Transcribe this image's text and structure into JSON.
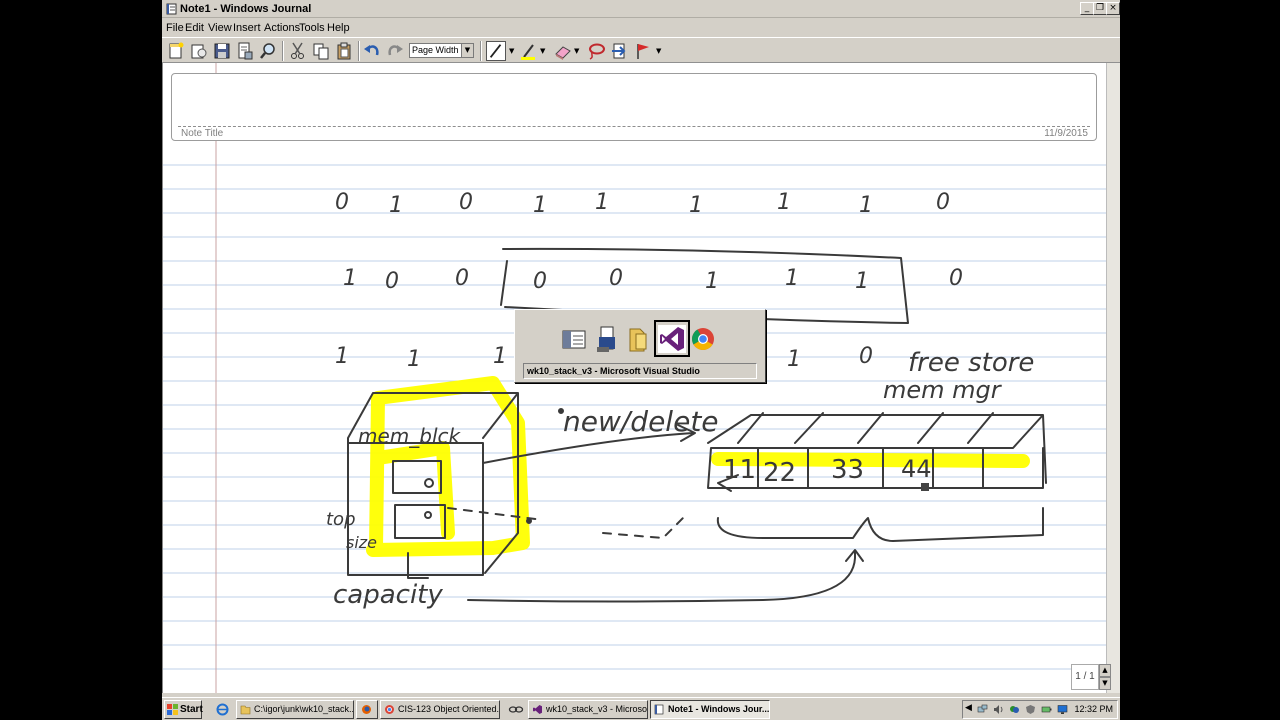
{
  "window": {
    "title": "Note1 - Windows Journal",
    "controls": {
      "minimize": "_",
      "restore": "❐",
      "close": "×"
    }
  },
  "menu": {
    "items": [
      "File",
      "Edit",
      "View",
      "Insert",
      "Actions",
      "Tools",
      "Help"
    ]
  },
  "toolbar": {
    "icons": [
      "new-note-icon",
      "open-icon",
      "save-icon",
      "print-icon",
      "find-icon",
      "cut-icon",
      "copy-icon",
      "paste-icon",
      "undo-icon",
      "redo-icon",
      "pen-icon",
      "highlighter-icon",
      "eraser-icon",
      "lasso-icon",
      "insert-space-icon",
      "flag-icon"
    ],
    "zoom_value": "Page Width"
  },
  "note": {
    "title_label": "Note Title",
    "date": "11/9/2015",
    "page_count": "1 / 1"
  },
  "ink": {
    "row1": [
      "0",
      "1",
      "0",
      "1",
      "1",
      "1",
      "1",
      "1",
      "0"
    ],
    "row2": [
      "1",
      "0",
      "0",
      "0",
      "0",
      "1",
      "1",
      "1",
      "0"
    ],
    "row3": [
      "1",
      "1",
      "1",
      "1",
      "0"
    ],
    "labels": {
      "free_store": "free store",
      "mem_mgr": "mem mgr",
      "new_delete": "new/delete",
      "mem_blck": "mem_blck",
      "top": "top",
      "size": "size",
      "capacity": "capacity"
    },
    "cells": [
      "11",
      "22",
      "33",
      "44"
    ],
    "colors": {
      "ink": "#3a3a3a",
      "highlight": "#ffff00"
    }
  },
  "switcher": {
    "icons": [
      "journal-app-icon",
      "journal-viewer-icon",
      "folder-icon",
      "visual-studio-icon",
      "chrome-icon"
    ],
    "selected_index": 3,
    "caption": "wk10_stack_v3 - Microsoft Visual Studio"
  },
  "taskbar": {
    "start_label": "Start",
    "quick_launch": [
      "ie-icon"
    ],
    "buttons": [
      {
        "label": "C:\\igor\\junk\\wk10_stack...",
        "icon": "folder-icon",
        "active": false
      },
      {
        "label": "",
        "icon": "firefox-icon",
        "active": false
      },
      {
        "label": "CIS-123 Object Oriented...",
        "icon": "chrome-icon",
        "active": false
      },
      {
        "label": "",
        "icon": "link-icon",
        "active": false
      },
      {
        "label": "wk10_stack_v3 - Microso...",
        "icon": "visual-studio-icon",
        "active": false
      },
      {
        "label": "Note1 - Windows Jour...",
        "icon": "journal-icon",
        "active": true
      }
    ],
    "tray_icons": [
      "expand-icon",
      "network-icon",
      "volume-icon",
      "chat-icon",
      "shield-icon",
      "power-icon",
      "display-icon",
      "security-icon"
    ],
    "clock": "12:32 PM"
  }
}
